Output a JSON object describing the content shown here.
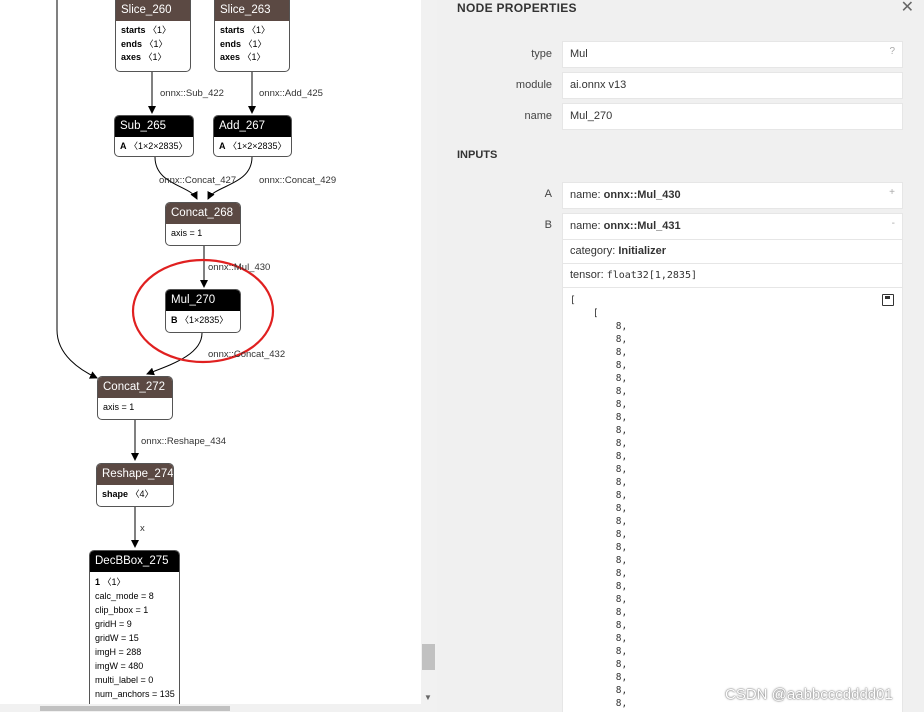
{
  "graph": {
    "nodes": {
      "slice_260": {
        "title": "Slice_260",
        "attrs": [
          {
            "k": "starts",
            "v": "〈1〉"
          },
          {
            "k": "ends",
            "v": "〈1〉"
          },
          {
            "k": "axes",
            "v": "〈1〉"
          }
        ]
      },
      "slice_263": {
        "title": "Slice_263",
        "attrs": [
          {
            "k": "starts",
            "v": "〈1〉"
          },
          {
            "k": "ends",
            "v": "〈1〉"
          },
          {
            "k": "axes",
            "v": "〈1〉"
          }
        ]
      },
      "sub_265": {
        "title": "Sub_265",
        "input": "A",
        "shape": "〈1×2×2835〉"
      },
      "add_267": {
        "title": "Add_267",
        "input": "A",
        "shape": "〈1×2×2835〉"
      },
      "concat_268": {
        "title": "Concat_268",
        "attr": "axis = 1"
      },
      "mul_270": {
        "title": "Mul_270",
        "input": "B",
        "shape": "〈1×2835〉"
      },
      "concat_272": {
        "title": "Concat_272",
        "attr": "axis = 1"
      },
      "reshape_274": {
        "title": "Reshape_274",
        "input": "shape",
        "shape": "〈4〉"
      },
      "decbbox_275": {
        "title": "DecBBox_275",
        "input": "1",
        "shape": "〈1〉",
        "attrs": [
          "calc_mode = 8",
          "clip_bbox = 1",
          "gridH = 9",
          "gridW = 15",
          "imgH = 288",
          "imgW = 480",
          "multi_label = 0",
          "num_anchors = 135"
        ]
      }
    },
    "edges": {
      "e1": "onnx::Sub_422",
      "e2": "onnx::Add_425",
      "e3": "onnx::Concat_427",
      "e4": "onnx::Concat_429",
      "e5": "onnx::Mul_430",
      "e6": "onnx::Concat_432",
      "e7": "onnx::Reshape_434",
      "e8": "x"
    }
  },
  "panel": {
    "title": "NODE PROPERTIES",
    "close": "✕",
    "props": [
      {
        "label": "type",
        "value": "Mul",
        "mark": "?"
      },
      {
        "label": "module",
        "value": "ai.onnx v13"
      },
      {
        "label": "name",
        "value": "Mul_270"
      }
    ],
    "inputs_heading": "INPUTS",
    "input_a": {
      "label": "A",
      "name_key": "name: ",
      "name_val": "onnx::Mul_430",
      "mark": "+"
    },
    "input_b": {
      "label": "B",
      "name_key": "name: ",
      "name_val": "onnx::Mul_431",
      "mark": "-",
      "category_key": "category: ",
      "category_val": "Initializer",
      "tensor_key": "tensor: ",
      "tensor_val": "float32[1,2835]",
      "tensor_text": "[\n    [\n        8,\n        8,\n        8,\n        8,\n        8,\n        8,\n        8,\n        8,\n        8,\n        8,\n        8,\n        8,\n        8,\n        8,\n        8,\n        8,\n        8,\n        8,\n        8,\n        8,\n        8,\n        8,\n        8,\n        8,\n        8,\n        8,\n        8,\n        8,\n        8,\n        8,\n        8,"
    }
  },
  "watermark": "CSDN @aabbcccdddd01",
  "colors": {
    "node_header": "#5b4943",
    "selected_header": "#000000",
    "highlight_circle": "#e02020",
    "panel_bg": "#f0f0f0"
  }
}
